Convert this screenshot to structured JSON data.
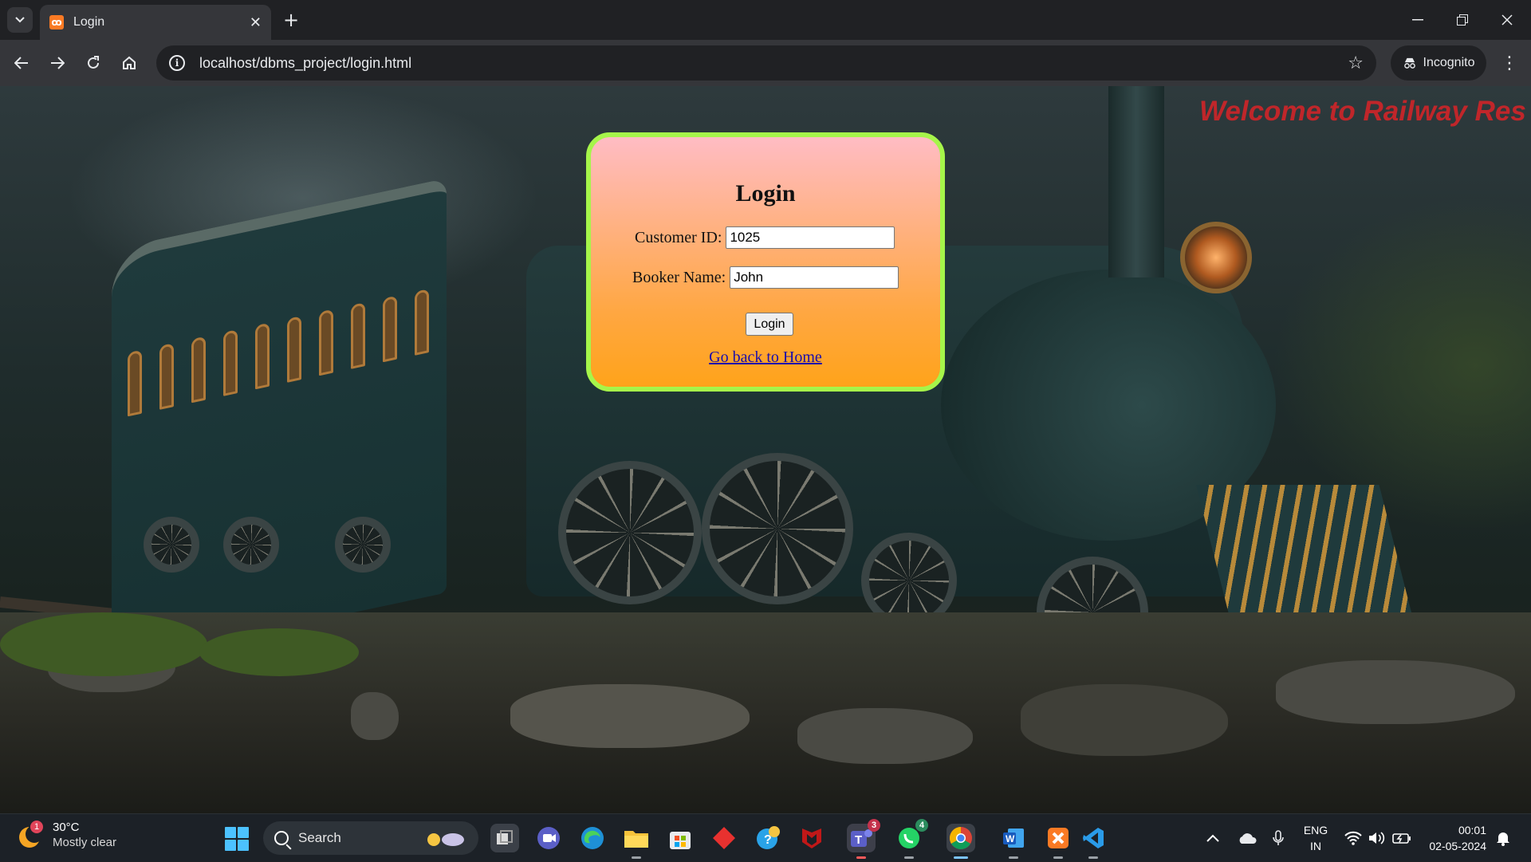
{
  "browser": {
    "tab_title": "Login",
    "favicon_glyph": "ꝏ",
    "tab_close_glyph": "✕",
    "new_tab_glyph": "+",
    "url": "localhost/dbms_project/login.html",
    "incognito_label": "Incognito",
    "icons": [
      "tab-search-icon",
      "back-icon",
      "forward-icon",
      "reload-icon",
      "home-icon",
      "site-info-icon",
      "bookmark-star-icon",
      "incognito-icon",
      "menu-kebab-icon",
      "minimize-icon",
      "restore-icon",
      "close-icon"
    ]
  },
  "page": {
    "welcome_text": "Welcome to Railway Res",
    "login": {
      "title": "Login",
      "customer_id_label": "Customer ID:",
      "customer_id_value": "1025",
      "booker_name_label": "Booker Name:",
      "booker_name_value": "John",
      "submit_label": "Login",
      "home_link": "Go back to Home"
    },
    "colors": {
      "box_border": "#a6f54a",
      "box_top": "#ffbcc4",
      "box_bottom": "#ffa31a",
      "welcome": "#c0262a",
      "link": "#1a0dab"
    }
  },
  "taskbar": {
    "weather_temp": "30°C",
    "weather_desc": "Mostly clear",
    "weather_badge": "1",
    "search_label": "Search",
    "apps": [
      {
        "name": "task-view-icon"
      },
      {
        "name": "meet-icon"
      },
      {
        "name": "edge-icon"
      },
      {
        "name": "file-explorer-icon"
      },
      {
        "name": "ms-store-icon"
      },
      {
        "name": "diamond-app-icon"
      },
      {
        "name": "copilot-icon"
      },
      {
        "name": "mcafee-icon"
      },
      {
        "name": "teams-icon",
        "badge": "3"
      },
      {
        "name": "whatsapp-icon",
        "badge": "4"
      },
      {
        "name": "chrome-icon"
      },
      {
        "name": "word-icon"
      },
      {
        "name": "xampp-icon"
      },
      {
        "name": "vscode-icon"
      }
    ],
    "lang_top": "ENG",
    "lang_bottom": "IN",
    "time": "00:01",
    "date": "02-05-2024"
  }
}
